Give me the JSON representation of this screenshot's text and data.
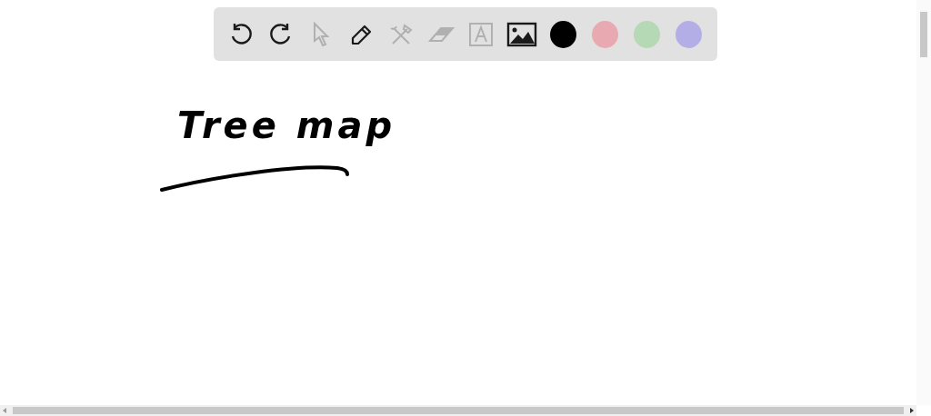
{
  "toolbar": {
    "tools": [
      {
        "kind": "undo",
        "disabled": false
      },
      {
        "kind": "redo",
        "disabled": false
      },
      {
        "kind": "pointer",
        "disabled": true
      },
      {
        "kind": "pen",
        "disabled": false
      },
      {
        "kind": "tools",
        "disabled": true
      },
      {
        "kind": "eraser",
        "disabled": true
      },
      {
        "kind": "text",
        "disabled": true
      },
      {
        "kind": "image",
        "disabled": false
      }
    ],
    "colors": [
      {
        "color": "#000000"
      },
      {
        "color": "#e8a9b0"
      },
      {
        "color": "#b5d8b5"
      },
      {
        "color": "#b3afe6"
      }
    ]
  },
  "canvas": {
    "heading": "Tree map"
  }
}
